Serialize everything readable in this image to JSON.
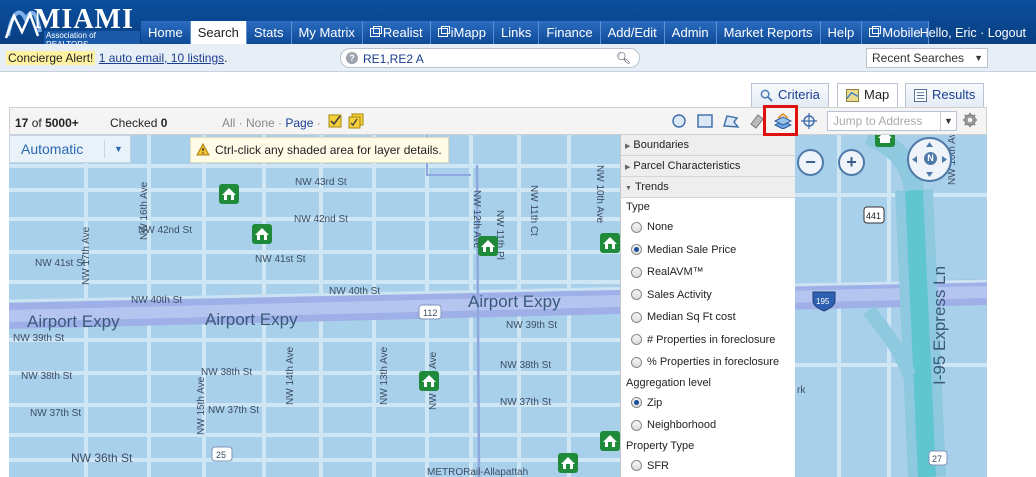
{
  "header": {
    "logo_title": "MIAMI",
    "logo_subtitle": "Association of REALTORS",
    "nav": [
      {
        "label": "Home",
        "window": false
      },
      {
        "label": "Search",
        "window": false,
        "active": true
      },
      {
        "label": "Stats",
        "window": false
      },
      {
        "label": "My Matrix",
        "window": false
      },
      {
        "label": "Realist",
        "window": true
      },
      {
        "label": "iMapp",
        "window": true
      },
      {
        "label": "Links",
        "window": false
      },
      {
        "label": "Finance",
        "window": false
      },
      {
        "label": "Add/Edit",
        "window": false
      },
      {
        "label": "Admin",
        "window": false
      },
      {
        "label": "Market Reports",
        "window": false
      },
      {
        "label": "Help",
        "window": false
      },
      {
        "label": "Mobile",
        "window": true
      }
    ],
    "greeting": "Hello, Eric",
    "separator": " · ",
    "logout": "Logout"
  },
  "alert": {
    "label": "Concierge Alert!",
    "link": "1 auto email, 10 listings",
    "period": "."
  },
  "search": {
    "value": "RE1,RE2 A"
  },
  "recent": {
    "label": "Recent Searches"
  },
  "view_tabs": {
    "criteria": "Criteria",
    "map": "Map",
    "results": "Results"
  },
  "toolbar": {
    "count_num": "17",
    "count_of": "of",
    "count_total": "5000+",
    "checked_label": "Checked",
    "checked_value": "0",
    "select_all": "All",
    "select_none": "None",
    "select_page": "Page",
    "dot": " · ",
    "jump_placeholder": "Jump to Address"
  },
  "map": {
    "mode": "Automatic",
    "hint": "Ctrl-click any shaded area for layer details.",
    "streets": {
      "s43": "NW 43rd St",
      "s42": "NW 42nd St",
      "s41": "NW 41st St",
      "s40": "NW 40th St",
      "s39": "NW 39th St",
      "s38": "NW 38th St",
      "s37": "NW 37th St",
      "s36": "NW 36th St",
      "a17": "NW 17th Ave",
      "a16": "NW 16th Ave",
      "a15": "NW 15th Ave",
      "a14": "NW 14th Ave",
      "a13": "NW 13th Ave",
      "a12": "NW 12th Ave",
      "a11": "NW 11th Pl",
      "a11ct": "NW 11th Ct",
      "a10": "NW 10th Ave",
      "airport": "Airport Expy",
      "i95": "I-95 Express Ln",
      "metro": "METRORail-Allapattah",
      "shield112": "112",
      "shield25": "25",
      "shield195": "195",
      "shield441": "441",
      "shield27": "27",
      "rk": "rk"
    }
  },
  "layers": {
    "boundaries": "Boundaries",
    "parcel": "Parcel Characteristics",
    "trends": "Trends",
    "type_label": "Type",
    "type_options": [
      "None",
      "Median Sale Price",
      "RealAVM™",
      "Sales Activity",
      "Median Sq Ft cost",
      "# Properties in foreclosure",
      "% Properties in foreclosure"
    ],
    "type_selected": 1,
    "aggregation_label": "Aggregation level",
    "aggregation_options": [
      "Zip",
      "Neighborhood"
    ],
    "aggregation_selected": 0,
    "property_type_label": "Property Type",
    "property_type_options": [
      "SFR"
    ]
  },
  "colors": {
    "header": "#0b4f9e",
    "map_bg": "#a9d0ea",
    "highway": "#9fb7e8",
    "marker": "#1f8b3a",
    "highlight": "#e01010"
  }
}
